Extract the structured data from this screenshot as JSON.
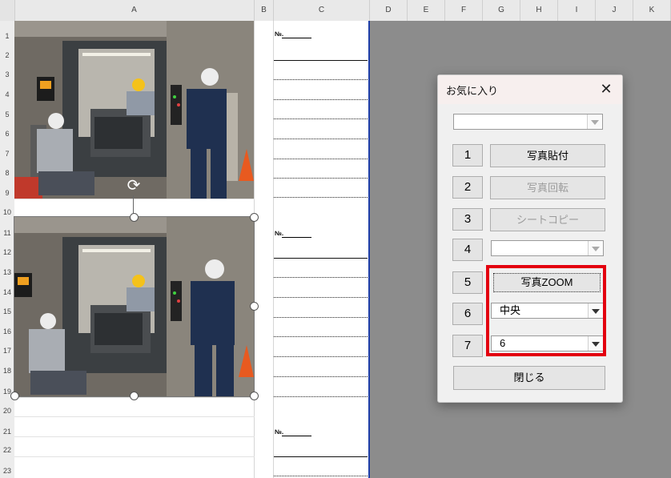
{
  "spreadsheet": {
    "columns": [
      "A",
      "B",
      "C",
      "D",
      "E",
      "F",
      "G",
      "H",
      "I",
      "J",
      "K"
    ],
    "rows": [
      "1",
      "2",
      "3",
      "4",
      "5",
      "6",
      "7",
      "8",
      "9",
      "10",
      "11",
      "12",
      "13",
      "14",
      "15",
      "16",
      "17",
      "18",
      "19",
      "20",
      "21",
      "22",
      "23"
    ],
    "number_label": "№."
  },
  "dialog": {
    "title": "お気に入り",
    "close": "✕",
    "top_combo_value": "",
    "numbers": [
      "1",
      "2",
      "3",
      "4",
      "5",
      "6",
      "7"
    ],
    "btn1": "写真貼付",
    "btn2": "写真回転",
    "btn3": "シートコピー",
    "combo4_value": "",
    "btn5": "写真ZOOM",
    "combo6_value": "中央",
    "combo7_value": "6",
    "close_button": "閉じる"
  },
  "colors": {
    "highlight": "#e3000f",
    "page_border": "#1f3fa8"
  }
}
